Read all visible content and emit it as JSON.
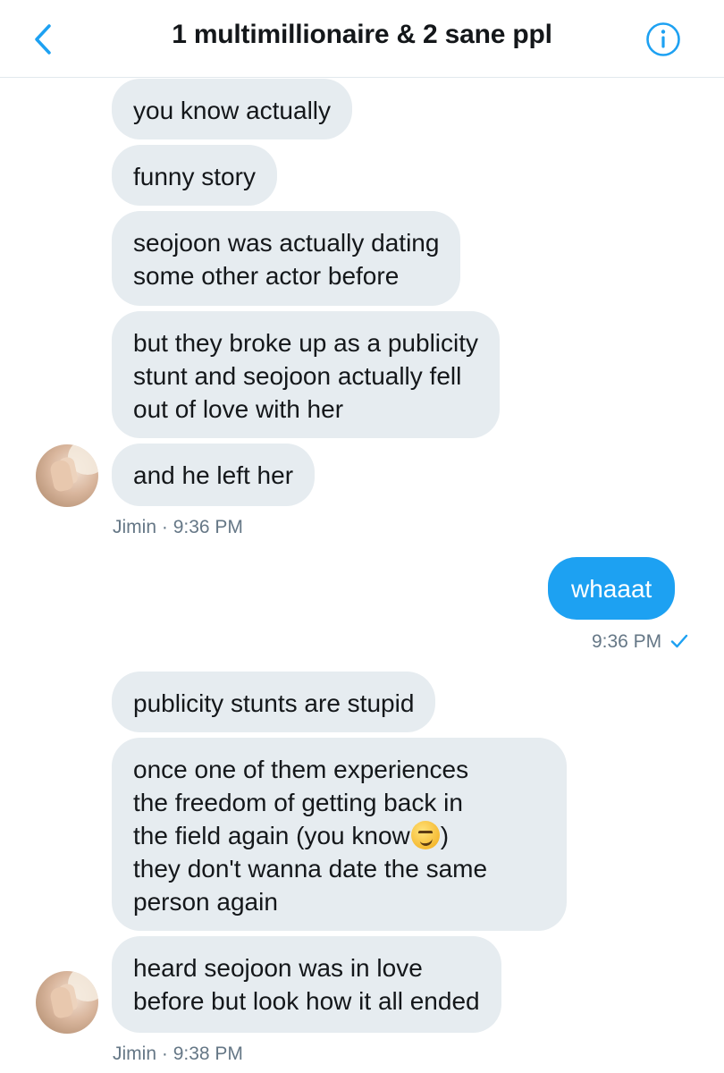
{
  "header": {
    "title": "1 multimillionaire & 2 sane ppl",
    "back_icon": "chevron-left-icon",
    "info_icon": "info-icon",
    "accent_color": "#1da1f2"
  },
  "conversation": {
    "group1": {
      "messages": [
        "you know actually",
        "funny story",
        "seojoon was actually dating\nsome other actor before",
        "but they broke up as a publicity\nstunt and seojoon actually fell\nout of love with her",
        "and he left her"
      ],
      "sender": "Jimin",
      "time": "9:36 PM"
    },
    "outgoing": {
      "message": "whaaat",
      "time": "9:36 PM",
      "status_icon": "checkmark-icon"
    },
    "group2": {
      "messages": [
        "publicity stunts are stupid",
        "once one of them experiences\nthe freedom of getting back in\nthe field again (you know",
        ")\nthey don't wanna date the same\nperson again",
        "heard seojoon was in love\nbefore but look how it all ended"
      ],
      "emoji_icon": "smirking-face-emoji",
      "sender": "Jimin",
      "time": "9:38 PM"
    }
  },
  "meta_separator": " · ",
  "colors": {
    "incoming_bubble": "#e6ecf0",
    "outgoing_bubble": "#1da1f2",
    "meta_text": "#657786"
  }
}
